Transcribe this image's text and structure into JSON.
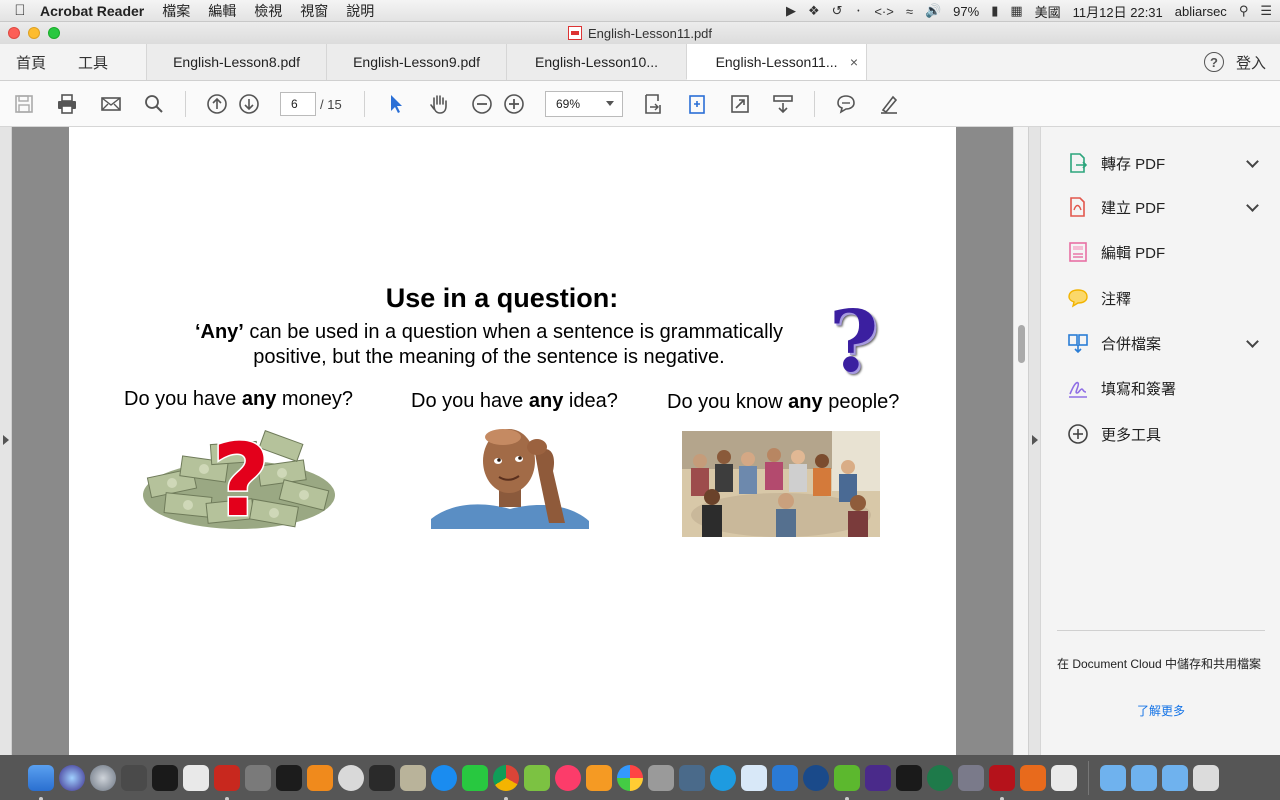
{
  "menubar": {
    "app_name": "Acrobat Reader",
    "menus": [
      "檔案",
      "編輯",
      "檢視",
      "視窗",
      "說明"
    ],
    "battery": "97%",
    "input_source": "美國",
    "datetime": "11月12日  22:31",
    "user": "abliarsec"
  },
  "window": {
    "title": "English-Lesson11.pdf"
  },
  "tabbar": {
    "home": "首頁",
    "tools": "工具",
    "tabs": [
      {
        "label": "English-Lesson8.pdf"
      },
      {
        "label": "English-Lesson9.pdf"
      },
      {
        "label": "English-Lesson10..."
      },
      {
        "label": "English-Lesson11..."
      }
    ],
    "close_glyph": "×",
    "help": "?",
    "login": "登入"
  },
  "toolbar": {
    "page_current": "6",
    "page_total": "/ 15",
    "zoom": "69%"
  },
  "slide": {
    "title": "Use in a question:",
    "desc_bold": "‘Any’",
    "desc_rest": " can be used in a question when a sentence is grammatically positive, but the meaning of the sentence is negative.",
    "qmark": "?",
    "questions": [
      {
        "pre": "Do you have ",
        "bold": "any",
        "post": " money?"
      },
      {
        "pre": "Do you have ",
        "bold": "any",
        "post": " idea?"
      },
      {
        "pre": "Do you know ",
        "bold": "any",
        "post": " people?"
      }
    ],
    "money_qmark": "?"
  },
  "sidepanel": {
    "items": [
      {
        "label": "轉存 PDF",
        "icon": "export-pdf-icon",
        "color": "#2ca57c"
      },
      {
        "label": "建立 PDF",
        "icon": "create-pdf-icon",
        "color": "#e2574c"
      },
      {
        "label": "編輯 PDF",
        "icon": "edit-pdf-icon",
        "color": "#e76fa3"
      },
      {
        "label": "注釋",
        "icon": "comment-icon",
        "color": "#f2b300"
      },
      {
        "label": "合併檔案",
        "icon": "combine-files-icon",
        "color": "#2a7dd5"
      },
      {
        "label": "填寫和簽署",
        "icon": "fill-sign-icon",
        "color": "#8f6ee5"
      },
      {
        "label": "更多工具",
        "icon": "more-tools-icon",
        "color": "#444444"
      }
    ],
    "cloud_text": "在 Document Cloud 中儲存和共用檔案",
    "learn_more": "了解更多"
  }
}
